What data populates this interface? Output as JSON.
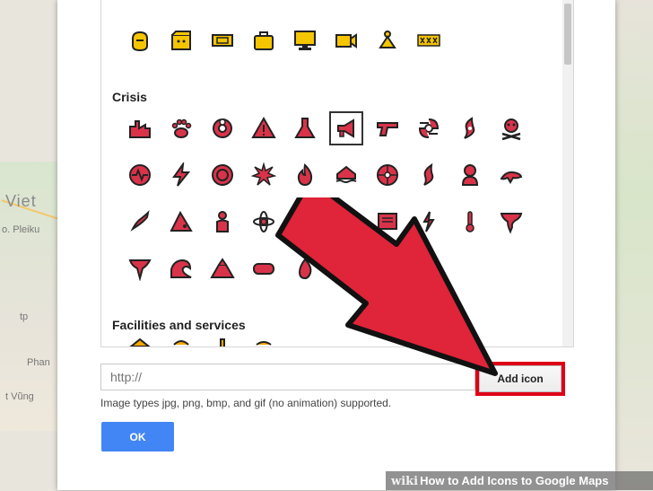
{
  "map": {
    "labels": [
      "Viet",
      "o. Pleiku",
      "tp",
      "Phan",
      "t Vũng"
    ]
  },
  "dialog": {
    "sections": [
      {
        "id": "crisis",
        "heading": "Crisis"
      },
      {
        "id": "facilities",
        "heading": "Facilities and services"
      }
    ],
    "top_icons": [
      "hand-icon",
      "clapper-icon",
      "ticket-icon",
      "luggage-icon",
      "monitor-icon",
      "camera-icon",
      "meditation-icon",
      "xxx-icon"
    ],
    "crisis_icons_row1": [
      "factory-icon",
      "paw-icon",
      "biohazard-icon",
      "warning-icon",
      "flask-icon",
      "megaphone-icon",
      "gun-icon",
      "hurricane-icon",
      "storm-icon",
      "skull-crossbones-icon"
    ],
    "crisis_icons_row2": [
      "heartbeat-icon",
      "lightning-icon",
      "target-icon",
      "explosion-icon",
      "fire-icon",
      "flood-house-icon",
      "cyclone-icon",
      "tropical-storm-icon",
      "sick-person-icon",
      "lizard-icon"
    ],
    "crisis_icons_row3": [
      "gecko-icon",
      "landslide-icon",
      "first-aid-person-icon",
      "atom-icon",
      "radiation-icon",
      "gas-mask-icon",
      "scroll-icon",
      "lightning-bolt-icon",
      "thermometer-icon",
      "tornado-icon"
    ],
    "crisis_icons_row4": [
      "tornado-small-icon",
      "tsunami-icon",
      "volcano-icon",
      "bomb-icon",
      "fire-small-icon"
    ],
    "url_input": {
      "value": "",
      "placeholder": "http://"
    },
    "add_icon_label": "Add icon",
    "hint": "Image types jpg, png, bmp, and gif (no animation) supported.",
    "ok_label": "OK"
  },
  "colors": {
    "crisis": "#d9334a",
    "top": "#f5c500",
    "ok": "#4285f4",
    "highlight": "#e00016"
  },
  "watermark": {
    "wiki": "wiki",
    "text": "How to Add Icons to Google Maps"
  }
}
